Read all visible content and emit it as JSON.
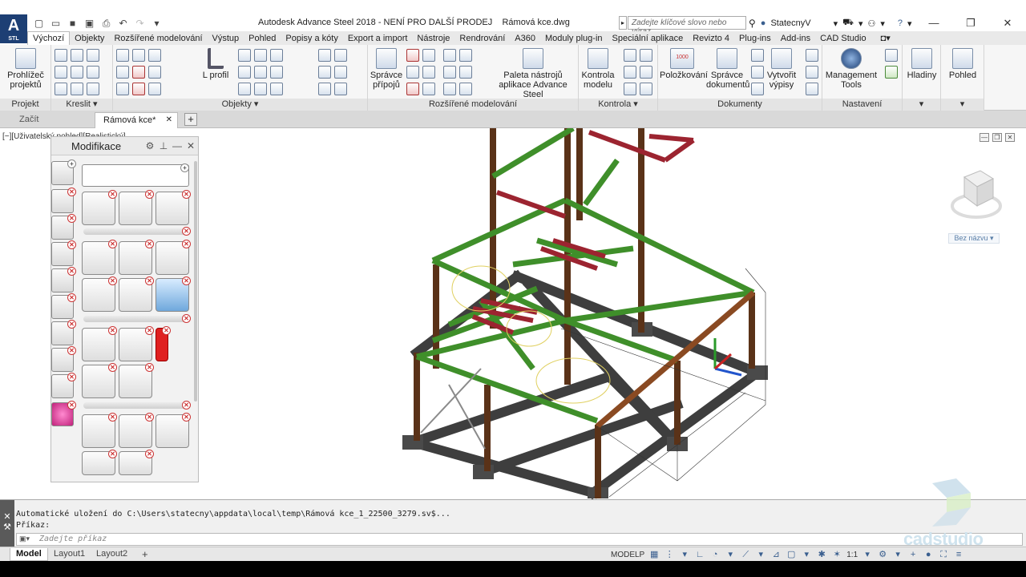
{
  "title": "Autodesk Advance Steel 2018 - NENÍ PRO DALŠÍ PRODEJ    Rámová kce.dwg",
  "app_logo": {
    "letter": "A",
    "sub": "STL"
  },
  "search": {
    "placeholder": "Zadejte klíčové slovo nebo výraz."
  },
  "user": {
    "name": "StatecnyV"
  },
  "qat_icons": [
    "new-icon",
    "open-icon",
    "save-icon",
    "saveas-icon",
    "print-icon",
    "undo-icon",
    "redo-icon",
    "dropdown-icon"
  ],
  "ribbon_tabs": [
    "Výchozí",
    "Objekty",
    "Rozšířené modelování",
    "Výstup",
    "Pohled",
    "Popisy a kóty",
    "Export a import",
    "Nástroje",
    "Rendrování",
    "A360",
    "Moduly plug-in",
    "Speciální aplikace",
    "Revizto 4",
    "Plug-ins",
    "Add-ins",
    "CAD Studio"
  ],
  "active_tab": "Výchozí",
  "ribbon": {
    "panels": [
      "Projekt",
      "Kreslit",
      "Objekty",
      "Rozšířené modelování",
      "Kontrola",
      "Dokumenty",
      "Nastavení"
    ],
    "buttons": {
      "project_explorer": "Prohlížeč projektů",
      "l_profile": "L profil",
      "connection_manager": "Správce přípojů",
      "tool_palette": "Paleta nástrojů aplikace Advance Steel",
      "model_check": "Kontrola modelu",
      "bom": "Položkování",
      "document_manager": "Správce dokumentů",
      "create_lists": "Vytvořit výpisy",
      "management_tools": "Management Tools",
      "layers": "Hladiny",
      "view": "Pohled"
    },
    "bom_number": "1000"
  },
  "file_tabs": {
    "start": "Začít",
    "current": "Rámová kce*"
  },
  "viewport": {
    "label": "[−][Uživatelský pohled][Realistický]",
    "viewcube_label": "Bez názvu"
  },
  "palette": {
    "title": "Modifikace"
  },
  "command": {
    "history1": "Automatické uložení do C:\\Users\\statecny\\appdata\\local\\temp\\Rámová kce_1_22500_3279.sv$...",
    "history2": "Příkaz:",
    "placeholder": "Zadejte příkaz"
  },
  "layout_tabs": [
    "Model",
    "Layout1",
    "Layout2"
  ],
  "status": {
    "space": "MODELP",
    "scale": "1:1"
  },
  "watermark": "cadstudio",
  "colors": {
    "steel_green": "#3f8f2a",
    "steel_brown": "#5a3218",
    "steel_red": "#9c2430",
    "concrete": "#4a4a4a",
    "accent": "#1d3f74"
  }
}
